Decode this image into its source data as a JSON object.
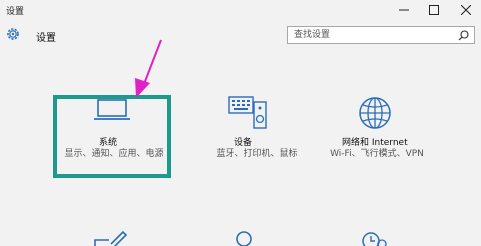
{
  "window": {
    "title": "设置",
    "minimize_icon": "minimize-icon",
    "maximize_icon": "maximize-icon",
    "close_icon": "close-icon"
  },
  "header": {
    "icon": "gear-icon",
    "title": "设置"
  },
  "search": {
    "placeholder": "查找设置",
    "icon": "search-icon"
  },
  "tiles": [
    {
      "name": "系统",
      "desc": "显示、通知、应用、电源",
      "icon": "laptop-icon"
    },
    {
      "name": "设备",
      "desc": "蓝牙、打印机、鼠标",
      "icon": "keyboard-speaker-icon"
    },
    {
      "name": "网络和 Internet",
      "desc": "Wi-Fi、飞行模式、VPN",
      "icon": "globe-icon"
    }
  ],
  "bottom_row_icons": [
    "pen-tablet-icon",
    "person-icon",
    "clock-icon"
  ],
  "colors": {
    "background": "#f2f2f2",
    "highlight": "#1c9b8d",
    "arrow": "#e020c8",
    "icon_blue": "#2a6ebb"
  }
}
